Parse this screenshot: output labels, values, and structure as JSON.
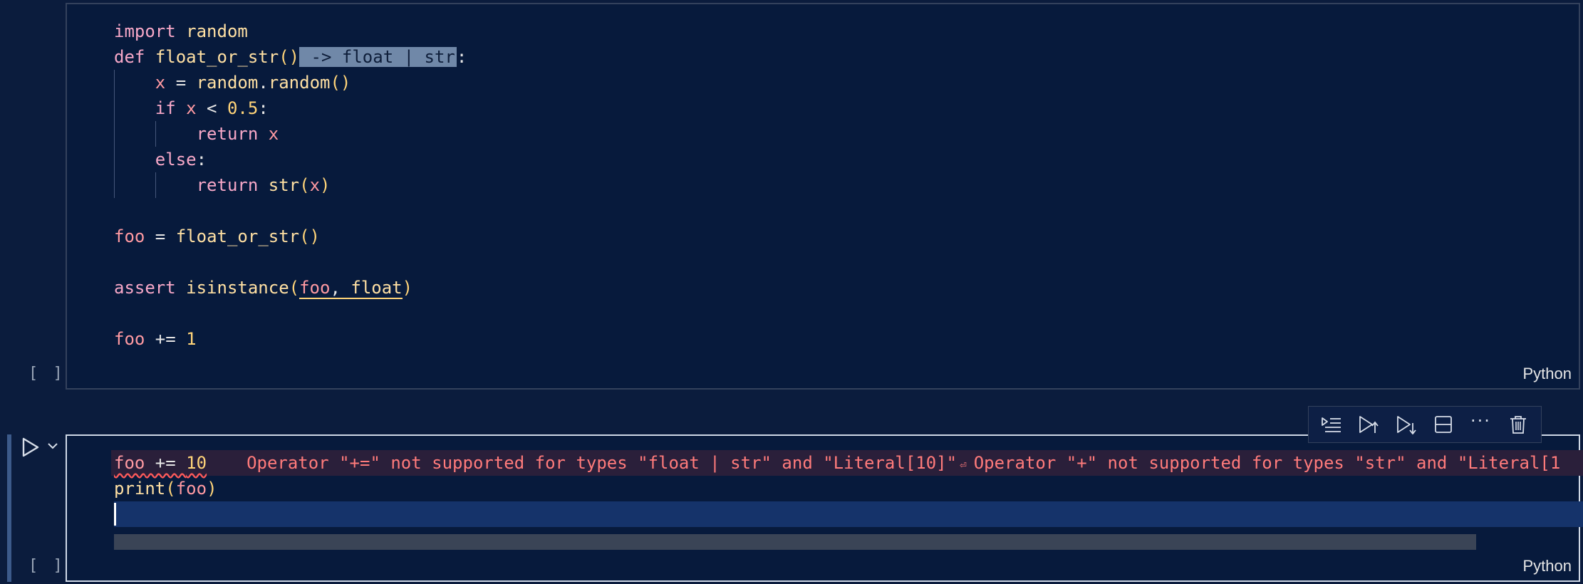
{
  "cells": [
    {
      "exec_count": "[ ]",
      "language": "Python",
      "lines": {
        "l1": {
          "kw": "import",
          "mod": "random"
        },
        "l2": {
          "kw": "def",
          "name": "float_or_str",
          "open": "(",
          "close": ")",
          "hint": " -> float | str",
          "colon": ":"
        },
        "l3": {
          "var": "x",
          "eq": " = ",
          "obj": "random",
          "dot": ".",
          "call": "random",
          "parens": "()"
        },
        "l4": {
          "kw": "if",
          "var": "x",
          "op": " < ",
          "num": "0.5",
          "colon": ":"
        },
        "l5": {
          "kw": "return",
          "var": "x"
        },
        "l6": {
          "kw": "else",
          "colon": ":"
        },
        "l7": {
          "kw": "return",
          "fn": "str",
          "open": "(",
          "arg": "x",
          "close": ")"
        },
        "l8": {
          "var": "foo",
          "eq": " = ",
          "fn": "float_or_str",
          "parens": "()"
        },
        "l9": {
          "kw": "assert",
          "fn": "isinstance",
          "open": "(",
          "arg1": "foo",
          "sep": ", ",
          "arg2": "float",
          "close": ")"
        },
        "l10": {
          "var": "foo",
          "op": " += ",
          "num": "1"
        }
      }
    },
    {
      "exec_count": "[ ]",
      "language": "Python",
      "lines": {
        "l1": {
          "var": "foo",
          "op": " += ",
          "num": "10"
        },
        "l2": {
          "fn": "print",
          "open": "(",
          "arg": "foo",
          "close": ")"
        }
      },
      "error_lens": {
        "message1": "Operator \"+=\" not supported for types \"float | str\" and \"Literal[10]\"",
        "wrap_glyph": "⏎",
        "message2": "Operator \"+\" not supported for types \"str\" and \"Literal[1"
      }
    }
  ],
  "toolbar": {
    "more_label": "···",
    "buttons": [
      "execute-above-icon",
      "execute-cell-and-above-icon",
      "execute-cell-and-below-icon",
      "split-cell-icon",
      "more-icon",
      "trash-icon"
    ]
  },
  "colors": {
    "background": "#0b1c3d",
    "editor_bg": "#071a3c",
    "keyword": "#f7a8c8",
    "function": "#ffe0a3",
    "variable": "#ff9aa2",
    "number": "#ffd479",
    "error": "#ff7b7b"
  }
}
